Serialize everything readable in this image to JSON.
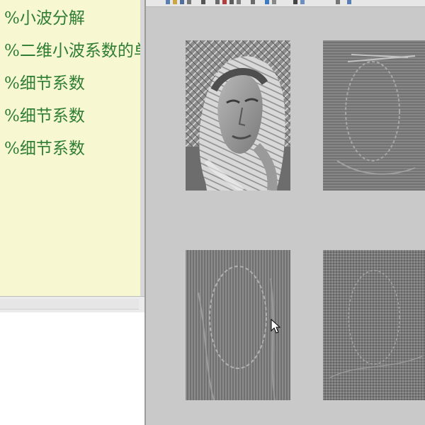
{
  "editor": {
    "lines": [
      "%小波分解",
      "%二维小波系数的单支",
      "%细节系数",
      "%细节系数",
      "%细节系数"
    ]
  },
  "figure": {
    "subplots": [
      {
        "icon": "image-icon"
      },
      {
        "icon": "image-icon"
      },
      {
        "icon": "image-icon"
      },
      {
        "icon": "image-icon"
      }
    ]
  },
  "colors": {
    "editor_bg": "#f7f7d2",
    "comment_text": "#2e7d32",
    "figure_bg": "#c9c9c9"
  }
}
